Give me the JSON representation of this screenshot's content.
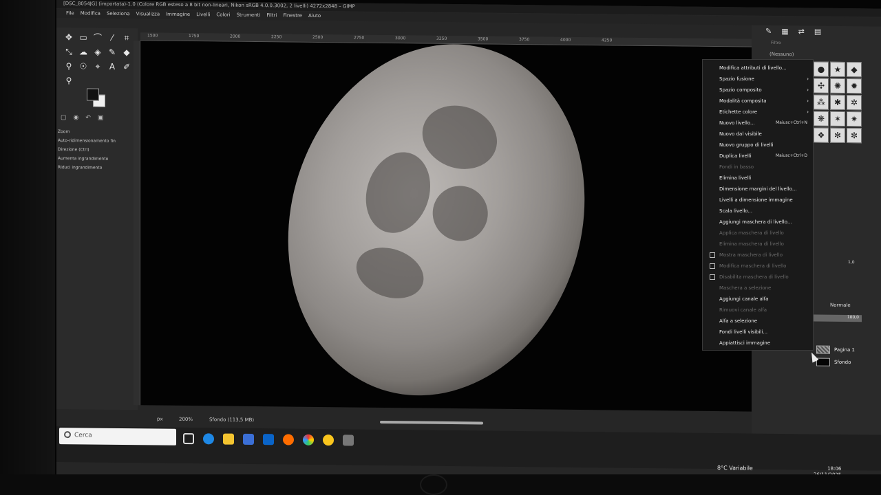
{
  "window": {
    "title": "[DSC_8054JG] (importata)-1.0 (Colore RGB esteso a 8 bit non-lineari, Nikon sRGB 4.0.0.3002, 2 livelli) 4272x2848 – GIMP"
  },
  "menubar": [
    "File",
    "Modifica",
    "Seleziona",
    "Visualizza",
    "Immagine",
    "Livelli",
    "Colori",
    "Strumenti",
    "Filtri",
    "Finestre",
    "Aiuto"
  ],
  "toolbox": {
    "tool_options_title": "Zoom",
    "options": [
      "Auto-ridimensionamento fin",
      "Direzione (Ctrl)",
      "Aumenta ingrandimento",
      "Riduci ingrandimento"
    ]
  },
  "ruler": [
    "1500",
    "1750",
    "2000",
    "2250",
    "2500",
    "2750",
    "3000",
    "3250",
    "3500",
    "3750",
    "4000",
    "4250"
  ],
  "statusbar": {
    "unit": "px",
    "zoom": "200%",
    "info": "Sfondo (113,5 MB)"
  },
  "dock": {
    "filter_placeholder": "Filtro",
    "brush_none": "(Nessuno)",
    "opacity_value": "1,0",
    "mode": "Normale",
    "opacity": "100,0",
    "layers": [
      {
        "name": "Pagina 1"
      },
      {
        "name": "Sfondo"
      }
    ]
  },
  "context_menu": [
    {
      "label": "Modifica attributi di livello...",
      "disabled": false
    },
    {
      "label": "Spazio fusione",
      "submenu": true,
      "disabled": false
    },
    {
      "label": "Spazio composito",
      "submenu": true,
      "disabled": false
    },
    {
      "label": "Modalità composita",
      "submenu": true,
      "disabled": false
    },
    {
      "label": "Etichette colore",
      "submenu": true,
      "disabled": false
    },
    {
      "label": "Nuovo livello...",
      "shortcut": "Maiusc+Ctrl+N",
      "disabled": false
    },
    {
      "label": "Nuovo dal visibile",
      "disabled": false
    },
    {
      "label": "Nuovo gruppo di livelli",
      "disabled": false
    },
    {
      "label": "Duplica livelli",
      "shortcut": "Maiusc+Ctrl+D",
      "disabled": false
    },
    {
      "label": "Fondi in basso",
      "disabled": true
    },
    {
      "label": "Elimina livelli",
      "disabled": false
    },
    {
      "label": "Dimensione margini del livello...",
      "disabled": false
    },
    {
      "label": "Livelli a dimensione immagine",
      "disabled": false
    },
    {
      "label": "Scala livello...",
      "disabled": false
    },
    {
      "label": "Aggiungi maschera di livello...",
      "disabled": false
    },
    {
      "label": "Applica maschera di livello",
      "disabled": true
    },
    {
      "label": "Elimina maschera di livello",
      "disabled": true
    },
    {
      "label": "Mostra maschera di livello",
      "checkbox": true,
      "disabled": true
    },
    {
      "label": "Modifica maschera di livello",
      "checkbox": true,
      "disabled": true
    },
    {
      "label": "Disabilita maschera di livello",
      "checkbox": true,
      "disabled": true
    },
    {
      "label": "Maschera a selezione",
      "disabled": true
    },
    {
      "label": "Aggiungi canale alfa",
      "disabled": false
    },
    {
      "label": "Rimuovi canale alfa",
      "disabled": true
    },
    {
      "label": "Alfa a selezione",
      "disabled": false
    },
    {
      "label": "Fondi livelli visibili...",
      "disabled": false
    },
    {
      "label": "Appiattisci immagine",
      "disabled": false
    }
  ],
  "taskbar": {
    "search_placeholder": "Cerca",
    "weather": "8°C Variabile",
    "time": "18:06",
    "date": "26/11/2025"
  }
}
